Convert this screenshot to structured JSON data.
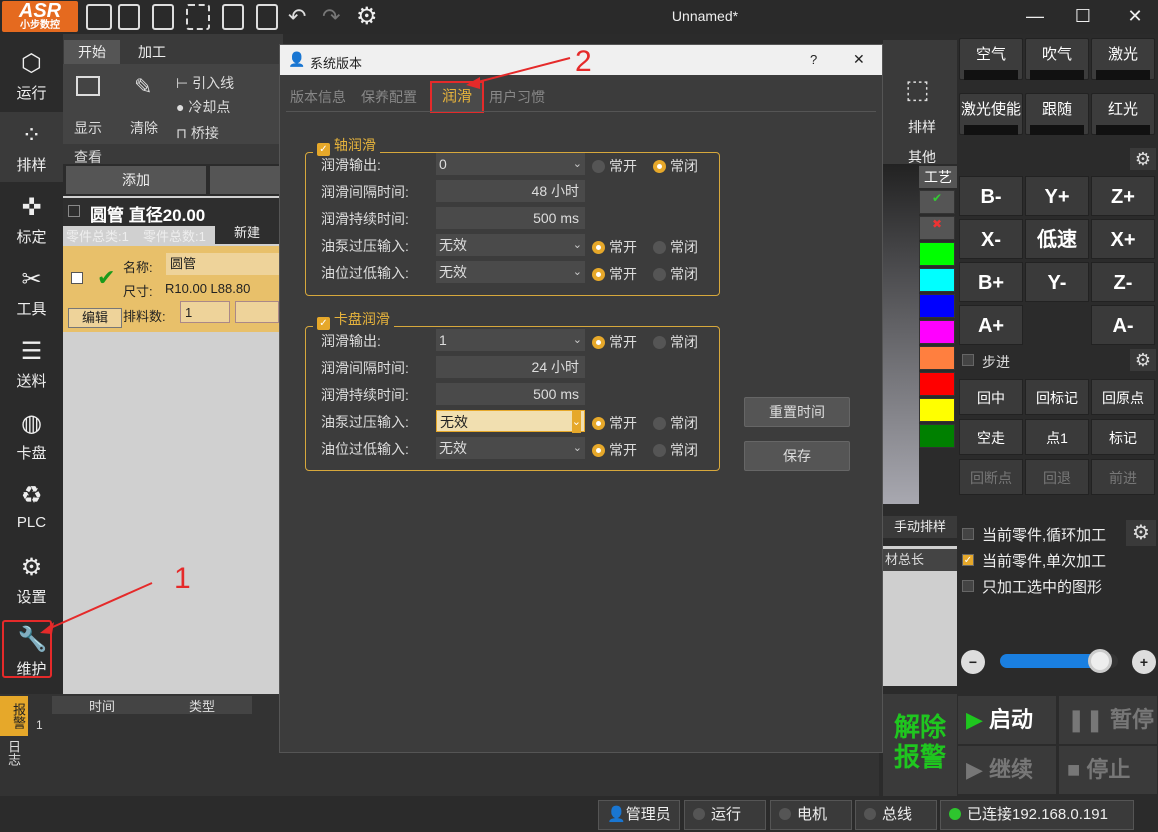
{
  "app": {
    "logo_text": "ASR",
    "logo_sub": "小步数控",
    "window_title": "Unnamed*"
  },
  "toolbar_icons": [
    "print-icon",
    "new-file-icon",
    "edit-icon",
    "film-icon",
    "save-icon",
    "save-as-icon",
    "undo-icon",
    "redo-icon",
    "gear-icon"
  ],
  "nav": [
    {
      "label": "运行",
      "icon": "cube-icon"
    },
    {
      "label": "排样",
      "icon": "grid-dots-icon"
    },
    {
      "label": "标定",
      "icon": "crosshair-icon"
    },
    {
      "label": "工具",
      "icon": "tools-icon"
    },
    {
      "label": "送料",
      "icon": "feed-icon"
    },
    {
      "label": "卡盘",
      "icon": "chuck-icon"
    },
    {
      "label": "PLC",
      "icon": "plc-icon"
    },
    {
      "label": "设置",
      "icon": "gear-icon"
    },
    {
      "label": "维护",
      "icon": "wrench-icon"
    }
  ],
  "ribbon": {
    "tabs": [
      "开始",
      "加工"
    ],
    "display": "显示",
    "clear": "清除",
    "view": "查看",
    "lead_line": "引入线",
    "cool_point": "冷却点",
    "bridge": "桥接",
    "nesting": "排样",
    "other": "其他",
    "add": "添加",
    "craft": "工艺"
  },
  "parts": {
    "title": "圆管 直径20.00",
    "total_types": "零件总类:1",
    "total_count": "零件总数:1",
    "new": "新建",
    "name_label": "名称:",
    "name_value": "圆管",
    "size_label": "尺寸:",
    "size_value": "R10.00 L88.80",
    "count_label": "排料数:",
    "count_value": "1",
    "edit": "编辑"
  },
  "log": {
    "tabs": [
      "报警",
      "日志"
    ],
    "headers": [
      "时间",
      "类型"
    ],
    "row_index": "1"
  },
  "dialog": {
    "title": "系统版本",
    "help": "?",
    "close": "✕",
    "tabs": [
      "版本信息",
      "保养配置",
      "润滑",
      "用户习惯"
    ],
    "axis_group": {
      "label": "轴润滑",
      "rows": [
        {
          "label": "润滑输出:",
          "type": "combo",
          "value": "0",
          "radio": [
            "常开",
            "常闭"
          ],
          "selected": 1
        },
        {
          "label": "润滑间隔时间:",
          "type": "field",
          "value": "48 小时"
        },
        {
          "label": "润滑持续时间:",
          "type": "field",
          "value": "500 ms"
        },
        {
          "label": "油泵过压输入:",
          "type": "combo",
          "value": "无效",
          "radio": [
            "常开",
            "常闭"
          ],
          "selected": 0
        },
        {
          "label": "油位过低输入:",
          "type": "combo",
          "value": "无效",
          "radio": [
            "常开",
            "常闭"
          ],
          "selected": 0
        }
      ]
    },
    "chuck_group": {
      "label": "卡盘润滑",
      "rows": [
        {
          "label": "润滑输出:",
          "type": "combo",
          "value": "1",
          "radio": [
            "常开",
            "常闭"
          ],
          "selected": 0
        },
        {
          "label": "润滑间隔时间:",
          "type": "field",
          "value": "24 小时"
        },
        {
          "label": "润滑持续时间:",
          "type": "field",
          "value": "500 ms"
        },
        {
          "label": "油泵过压输入:",
          "type": "combo",
          "value": "无效",
          "radio": [
            "常开",
            "常闭"
          ],
          "selected": 0,
          "highlight": true
        },
        {
          "label": "油位过低输入:",
          "type": "combo",
          "value": "无效",
          "radio": [
            "常开",
            "常闭"
          ],
          "selected": 0
        }
      ]
    },
    "reset_time": "重置时间",
    "save": "保存"
  },
  "right": {
    "gas": [
      "空气",
      "吹气",
      "激光",
      "激光使能",
      "跟随",
      "红光"
    ],
    "jog": [
      "B-",
      "Y+",
      "Z+",
      "X-",
      "低速",
      "X+",
      "B+",
      "Y-",
      "Z-",
      "A+",
      "",
      "A-"
    ],
    "step": "步进",
    "moves": [
      "回中",
      "回标记",
      "回原点",
      "空走",
      "点1",
      "标记",
      "回断点",
      "回退",
      "前进"
    ],
    "manual_nest": "手动排样",
    "total_length": "材总长",
    "opts": [
      {
        "label": "当前零件,循环加工",
        "checked": false
      },
      {
        "label": "当前零件,单次加工",
        "checked": true
      },
      {
        "label": "只加工选中的图形",
        "checked": false
      }
    ],
    "speed": 0.85,
    "release_alarm": "解除报警",
    "start": "启动",
    "pause": "暂停",
    "resume": "继续",
    "stop": "停止"
  },
  "colors": [
    "#00ff00",
    "#00ffff",
    "#0000ff",
    "#ff00ff",
    "#ff7f3f",
    "#ff0000",
    "#ffff00",
    "#008000"
  ],
  "status": {
    "user": "管理员",
    "run": "运行",
    "motor": "电机",
    "bus": "总线",
    "connected": "已连接192.168.0.191"
  },
  "annotations": [
    "1",
    "2"
  ]
}
